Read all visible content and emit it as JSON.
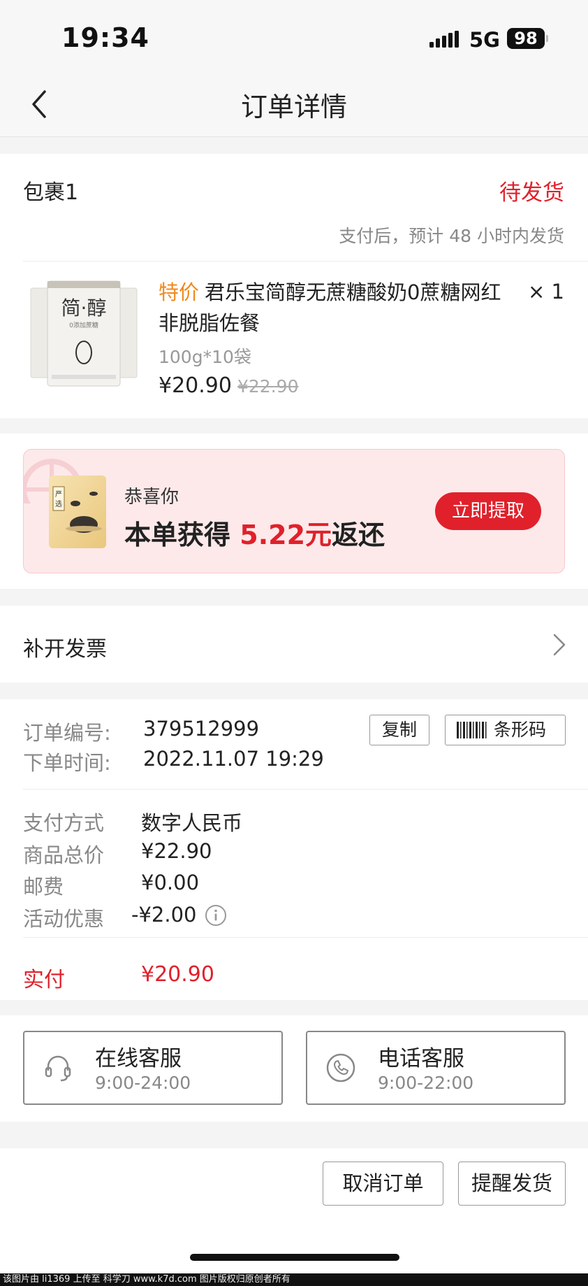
{
  "status_bar": {
    "time": "19:34",
    "network": "5G",
    "battery": "98"
  },
  "nav": {
    "title": "订单详情"
  },
  "package": {
    "title": "包裹1",
    "status": "待发货",
    "note": "支付后，预计 48 小时内发货"
  },
  "product": {
    "tag": "特价",
    "name": "君乐宝简醇无蔗糖酸奶0蔗糖网红非脱脂佐餐",
    "spec": "100g*10袋",
    "price": "¥20.90",
    "original_price": "¥22.90",
    "quantity": "× 1"
  },
  "reward": {
    "small": "恭喜你",
    "prefix": "本单获得",
    "amount": "5.22元",
    "suffix": "返还",
    "button": "立即提取"
  },
  "invoice": {
    "label": "补开发票"
  },
  "order": {
    "number_label": "订单编号:",
    "number": "379512999",
    "copy_label": "复制",
    "barcode_label": "条形码",
    "time_label": "下单时间:",
    "time": "2022.11.07 19:29"
  },
  "payment": {
    "method_label": "支付方式",
    "method": "数字人民币",
    "total_label": "商品总价",
    "total": "¥22.90",
    "shipping_label": "邮费",
    "shipping": "¥0.00",
    "promo_label": "活动优惠",
    "promo": "-¥2.00",
    "paid_label": "实付",
    "paid": "¥20.90"
  },
  "service": {
    "online_title": "在线客服",
    "online_hours": "9:00-24:00",
    "phone_title": "电话客服",
    "phone_hours": "9:00-22:00"
  },
  "actions": {
    "cancel": "取消订单",
    "remind": "提醒发货"
  },
  "watermark": "该图片由 li1369 上传至 科学刀 www.k7d.com 图片版权归原创者所有",
  "colors": {
    "accent_red": "#e0212b",
    "tag_orange": "#f08a1c"
  }
}
